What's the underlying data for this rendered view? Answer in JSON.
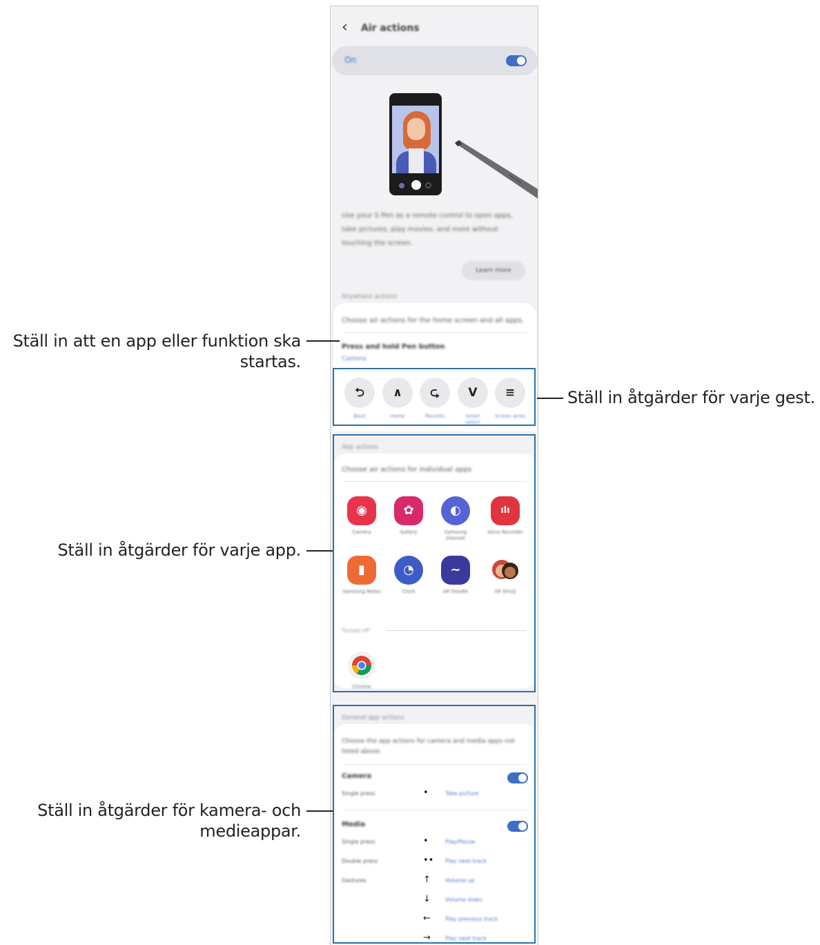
{
  "screen": {
    "back_glyph": "‹",
    "title": "Air actions",
    "on_label": "On",
    "description": "Use your S Pen as a remote control to open apps, take pictures, play movies, and more without touching the screen.",
    "learn_more": "Learn more",
    "anywhere_title": "Anywhere actions",
    "anywhere_desc": "Choose air actions for the home screen and all apps.",
    "press_hold_title": "Press and hold Pen button",
    "press_hold_value": "Camera",
    "gestures": [
      {
        "glyph": "⮌",
        "label": "Back",
        "icon": "gesture-back-icon"
      },
      {
        "glyph": "∧",
        "label": "Home",
        "icon": "gesture-home-icon"
      },
      {
        "glyph": "⮎",
        "label": "Recents",
        "icon": "gesture-recents-icon"
      },
      {
        "glyph": "V",
        "label": "Smart select",
        "icon": "gesture-smart-select-icon"
      },
      {
        "glyph": "≡",
        "label": "Screen write",
        "icon": "gesture-screen-write-icon"
      }
    ],
    "app_actions_title": "App actions",
    "app_actions_desc": "Choose air actions for individual apps",
    "apps": [
      {
        "label": "Camera",
        "icon": "camera-app-icon",
        "color": "#e8344b",
        "glyph": "◉"
      },
      {
        "label": "Gallery",
        "icon": "gallery-app-icon",
        "color": "#d8296b",
        "glyph": "✿"
      },
      {
        "label": "Samsung Internet",
        "icon": "internet-app-icon",
        "color": "#5563d4",
        "glyph": "◐"
      },
      {
        "label": "Voice Recorder",
        "icon": "voice-recorder-app-icon",
        "color": "#e0353d",
        "glyph": "ılı"
      },
      {
        "label": "Samsung Notes",
        "icon": "notes-app-icon",
        "color": "#ee6a35",
        "glyph": "▮"
      },
      {
        "label": "Clock",
        "icon": "clock-app-icon",
        "color": "#3e5cc8",
        "glyph": "◔"
      },
      {
        "label": "AR Doodle",
        "icon": "ar-doodle-app-icon",
        "color": "#3a3a9c",
        "glyph": "~"
      },
      {
        "label": "AR Emoji",
        "icon": "ar-emoji-app-icon",
        "color": "#f1f1f1",
        "glyph": "☺"
      }
    ],
    "turned_off_label": "Turned off",
    "turned_off_apps": [
      {
        "label": "Chrome",
        "icon": "chrome-app-icon"
      }
    ],
    "general_title": "General app actions",
    "general_desc": "Choose the app actions for camera and media apps not listed above.",
    "camera_title": "Camera",
    "camera_actions": [
      {
        "label": "Single press",
        "sym": "•",
        "value": "Take picture"
      }
    ],
    "media_title": "Media",
    "media_actions": [
      {
        "label": "Single press",
        "sym": "•",
        "value": "Play/Pause"
      },
      {
        "label": "Double press",
        "sym": "••",
        "value": "Play next track"
      },
      {
        "label": "Gestures",
        "sym": "↑",
        "value": "Volume up"
      },
      {
        "label": "",
        "sym": "↓",
        "value": "Volume down"
      },
      {
        "label": "",
        "sym": "←",
        "value": "Play previous track"
      },
      {
        "label": "",
        "sym": "→",
        "value": "Play next track"
      }
    ]
  },
  "callouts": {
    "anywhere_line1": "Ställ in att en app eller funktion ska",
    "anywhere_line2": "startas.",
    "gestures": "Ställ in åtgärder för varje gest.",
    "apps": "Ställ in åtgärder för varje app.",
    "media_line1": "Ställ in åtgärder för kamera- och",
    "media_line2": "medieappar."
  },
  "colors": {
    "accent": "#3e6fc6",
    "highlight_box": "#2a6fa8"
  }
}
